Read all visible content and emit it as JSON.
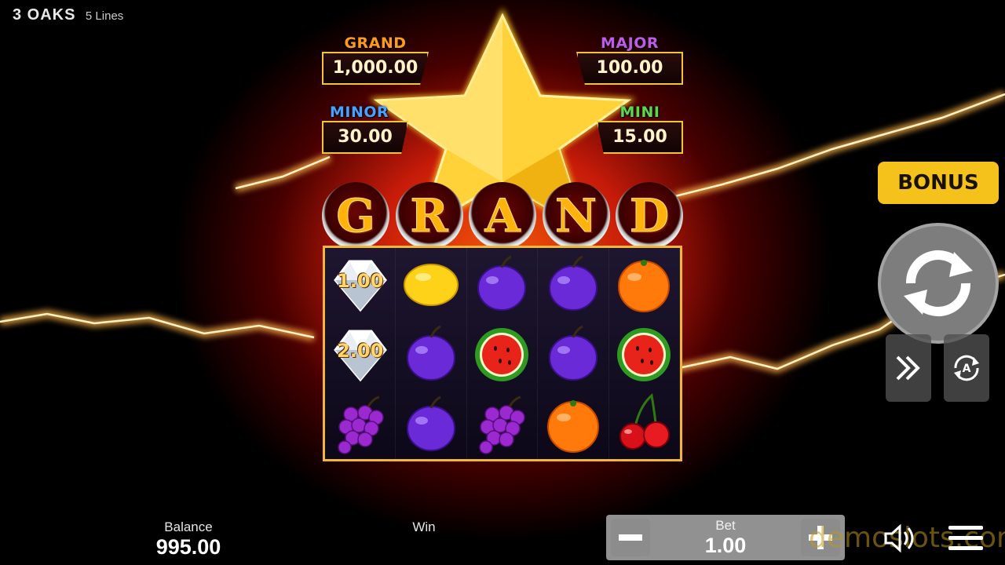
{
  "game": {
    "title": "3 OAKS",
    "lines": "5 Lines"
  },
  "jackpots": {
    "grand": {
      "label": "GRAND",
      "value": "1,000.00",
      "color": "#ff9a1a"
    },
    "major": {
      "label": "MAJOR",
      "value": "100.00",
      "color": "#b04ad8"
    },
    "minor": {
      "label": "MINOR",
      "value": "30.00",
      "color": "#3a8ee8"
    },
    "mini": {
      "label": "MINI",
      "value": "15.00",
      "color": "#4cc23a"
    }
  },
  "grand_letters": [
    "G",
    "R",
    "A",
    "N",
    "D"
  ],
  "reels": [
    [
      {
        "symbol": "diamond-icon",
        "value": "1.00"
      },
      {
        "symbol": "lemon-icon"
      },
      {
        "symbol": "plum-icon"
      },
      {
        "symbol": "plum-icon"
      },
      {
        "symbol": "orange-icon"
      }
    ],
    [
      {
        "symbol": "diamond-icon",
        "value": "2.00"
      },
      {
        "symbol": "plum-icon"
      },
      {
        "symbol": "watermelon-icon"
      },
      {
        "symbol": "plum-icon"
      },
      {
        "symbol": "watermelon-icon"
      }
    ],
    [
      {
        "symbol": "grapes-icon"
      },
      {
        "symbol": "plum-icon"
      },
      {
        "symbol": "grapes-icon"
      },
      {
        "symbol": "orange-icon"
      },
      {
        "symbol": "cherries-icon"
      }
    ]
  ],
  "controls": {
    "bonus_label": "BONUS"
  },
  "footer": {
    "balance_label": "Balance",
    "balance_value": "995.00",
    "win_label": "Win",
    "bet_label": "Bet",
    "bet_value": "1.00",
    "watermark": "demoslots.com"
  },
  "colors": {
    "accent": "#f4c21a",
    "frame": "#f0b73a"
  }
}
